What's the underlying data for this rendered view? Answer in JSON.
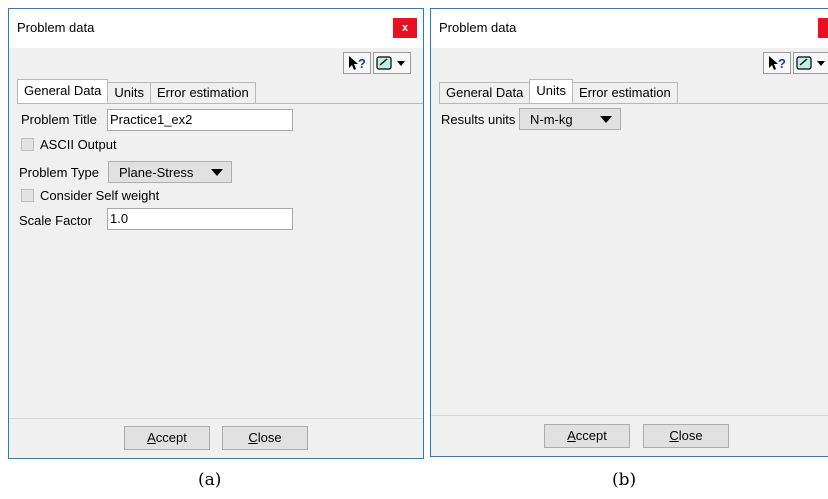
{
  "window_a": {
    "title": "Problem data",
    "close_label": "x",
    "tabs": [
      "General Data",
      "Units",
      "Error estimation"
    ],
    "active_tab": 0,
    "problem_title_label": "Problem Title",
    "problem_title_value": "Practice1_ex2",
    "ascii_output_label": "ASCII Output",
    "problem_type_label": "Problem Type",
    "problem_type_value": "Plane-Stress",
    "self_weight_label": "Consider Self weight",
    "scale_factor_label": "Scale Factor",
    "scale_factor_value": "1.0",
    "accept_prefix": "A",
    "accept_rest": "ccept",
    "close_prefix": "C",
    "close_rest": "lose"
  },
  "window_b": {
    "title": "Problem data",
    "tabs": [
      "General Data",
      "Units",
      "Error estimation"
    ],
    "active_tab": 1,
    "results_units_label": "Results units",
    "results_units_value": "N-m-kg",
    "accept_prefix": "A",
    "accept_rest": "ccept",
    "close_prefix": "C",
    "close_rest": "lose"
  },
  "captions": {
    "a": "(a)",
    "b": "(b)"
  },
  "icons": {
    "help": "context-help-icon",
    "notes": "notes-icon"
  },
  "colors": {
    "close_red": "#e81123",
    "window_border": "#1e7fd0",
    "dialog_bg": "#f0f0f0"
  }
}
